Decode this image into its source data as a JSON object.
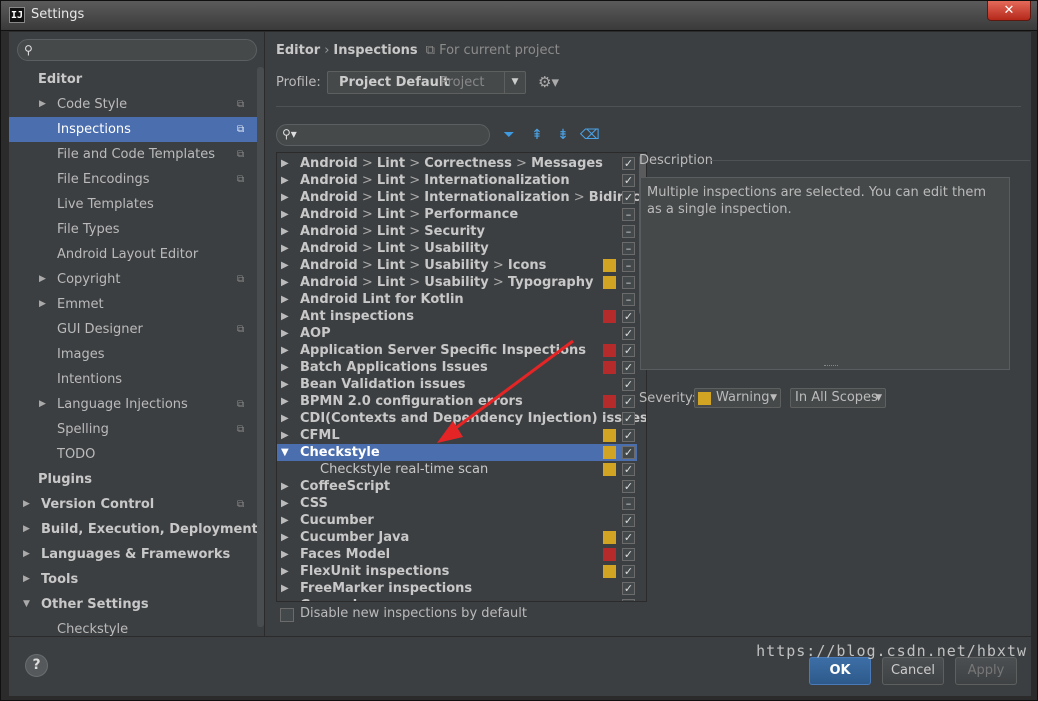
{
  "window": {
    "title": "Settings",
    "logo": "IJ",
    "close_glyph": "✕"
  },
  "sidebar": {
    "search_placeholder": "",
    "items": [
      {
        "label": "Editor",
        "level": 0,
        "arrow": "",
        "bold": true,
        "proj": false
      },
      {
        "label": "Code Style",
        "level": 1,
        "arrow": "▶",
        "bold": false,
        "proj": true
      },
      {
        "label": "Inspections",
        "level": 1,
        "arrow": "",
        "bold": false,
        "proj": true,
        "selected": true
      },
      {
        "label": "File and Code Templates",
        "level": 1,
        "arrow": "",
        "bold": false,
        "proj": true
      },
      {
        "label": "File Encodings",
        "level": 1,
        "arrow": "",
        "bold": false,
        "proj": true
      },
      {
        "label": "Live Templates",
        "level": 1,
        "arrow": "",
        "bold": false,
        "proj": false
      },
      {
        "label": "File Types",
        "level": 1,
        "arrow": "",
        "bold": false,
        "proj": false
      },
      {
        "label": "Android Layout Editor",
        "level": 1,
        "arrow": "",
        "bold": false,
        "proj": false
      },
      {
        "label": "Copyright",
        "level": 1,
        "arrow": "▶",
        "bold": false,
        "proj": true
      },
      {
        "label": "Emmet",
        "level": 1,
        "arrow": "▶",
        "bold": false,
        "proj": false
      },
      {
        "label": "GUI Designer",
        "level": 1,
        "arrow": "",
        "bold": false,
        "proj": true
      },
      {
        "label": "Images",
        "level": 1,
        "arrow": "",
        "bold": false,
        "proj": false
      },
      {
        "label": "Intentions",
        "level": 1,
        "arrow": "",
        "bold": false,
        "proj": false
      },
      {
        "label": "Language Injections",
        "level": 1,
        "arrow": "▶",
        "bold": false,
        "proj": true
      },
      {
        "label": "Spelling",
        "level": 1,
        "arrow": "",
        "bold": false,
        "proj": true
      },
      {
        "label": "TODO",
        "level": 1,
        "arrow": "",
        "bold": false,
        "proj": false
      },
      {
        "label": "Plugins",
        "level": 0,
        "arrow": "",
        "bold": true,
        "proj": false
      },
      {
        "label": "Version Control",
        "level": 0,
        "arrow": "▶",
        "bold": true,
        "proj": true
      },
      {
        "label": "Build, Execution, Deployment",
        "level": 0,
        "arrow": "▶",
        "bold": true,
        "proj": false
      },
      {
        "label": "Languages & Frameworks",
        "level": 0,
        "arrow": "▶",
        "bold": true,
        "proj": false
      },
      {
        "label": "Tools",
        "level": 0,
        "arrow": "▶",
        "bold": true,
        "proj": false
      },
      {
        "label": "Other Settings",
        "level": 0,
        "arrow": "▼",
        "bold": true,
        "proj": false
      },
      {
        "label": "Checkstyle",
        "level": 1,
        "arrow": "",
        "bold": false,
        "proj": false
      }
    ]
  },
  "header": {
    "crumb1": "Editor",
    "sep": "›",
    "crumb2": "Inspections",
    "project_note": "For current project",
    "profile_label": "Profile:",
    "profile_value": "Project Default",
    "profile_scope": "Project"
  },
  "inspections": [
    {
      "parts": [
        "Android",
        "Lint",
        "Correctness",
        "Messages"
      ],
      "sev": "",
      "check": "✓"
    },
    {
      "parts": [
        "Android",
        "Lint",
        "Internationalization"
      ],
      "sev": "",
      "check": "✓"
    },
    {
      "parts": [
        "Android",
        "Lint",
        "Internationalization",
        "Bidirecti"
      ],
      "sev": "",
      "check": "✓"
    },
    {
      "parts": [
        "Android",
        "Lint",
        "Performance"
      ],
      "sev": "",
      "check": "–"
    },
    {
      "parts": [
        "Android",
        "Lint",
        "Security"
      ],
      "sev": "",
      "check": "–"
    },
    {
      "parts": [
        "Android",
        "Lint",
        "Usability"
      ],
      "sev": "",
      "check": "–"
    },
    {
      "parts": [
        "Android",
        "Lint",
        "Usability",
        "Icons"
      ],
      "sev": "#d1a423",
      "check": "–"
    },
    {
      "parts": [
        "Android",
        "Lint",
        "Usability",
        "Typography"
      ],
      "sev": "#d1a423",
      "check": "–"
    },
    {
      "parts": [
        "Android Lint for Kotlin"
      ],
      "sev": "",
      "check": "–"
    },
    {
      "parts": [
        "Ant inspections"
      ],
      "sev": "#b52a2a",
      "check": "✓"
    },
    {
      "parts": [
        "AOP"
      ],
      "sev": "",
      "check": "✓"
    },
    {
      "parts": [
        "Application Server Specific Inspections"
      ],
      "sev": "#b52a2a",
      "check": "✓"
    },
    {
      "parts": [
        "Batch Applications Issues"
      ],
      "sev": "#b52a2a",
      "check": "✓"
    },
    {
      "parts": [
        "Bean Validation issues"
      ],
      "sev": "",
      "check": "✓"
    },
    {
      "parts": [
        "BPMN 2.0 configuration errors"
      ],
      "sev": "#b52a2a",
      "check": "✓"
    },
    {
      "parts": [
        "CDI(Contexts and Dependency Injection) issues"
      ],
      "sev": "",
      "check": "✓"
    },
    {
      "parts": [
        "CFML"
      ],
      "sev": "#d1a423",
      "check": "✓"
    },
    {
      "parts": [
        "Checkstyle"
      ],
      "sev": "#d1a423",
      "check": "✓",
      "selected": true,
      "expanded": true
    },
    {
      "parts": [
        "Checkstyle real-time scan"
      ],
      "sev": "#d1a423",
      "check": "✓",
      "child": true
    },
    {
      "parts": [
        "CoffeeScript"
      ],
      "sev": "",
      "check": "✓"
    },
    {
      "parts": [
        "CSS"
      ],
      "sev": "",
      "check": "–"
    },
    {
      "parts": [
        "Cucumber"
      ],
      "sev": "",
      "check": "✓"
    },
    {
      "parts": [
        "Cucumber Java"
      ],
      "sev": "#d1a423",
      "check": "✓"
    },
    {
      "parts": [
        "Faces Model"
      ],
      "sev": "#b52a2a",
      "check": "✓"
    },
    {
      "parts": [
        "FlexUnit inspections"
      ],
      "sev": "#d1a423",
      "check": "✓"
    },
    {
      "parts": [
        "FreeMarker inspections"
      ],
      "sev": "",
      "check": "✓"
    },
    {
      "parts": [
        "General"
      ],
      "sev": "",
      "check": "✓"
    }
  ],
  "description": {
    "label": "Description",
    "text": "Multiple inspections are selected. You can edit them as a single inspection."
  },
  "severity": {
    "label": "Severity:",
    "value": "Warning",
    "color": "#d1a423",
    "scope": "In All Scopes"
  },
  "disable_new": "Disable new inspections by default",
  "footer": {
    "help": "?",
    "ok": "OK",
    "cancel": "Cancel",
    "apply": "Apply"
  },
  "watermark": "https://blog.csdn.net/hbxtw",
  "colors": {
    "accent": "#4b6eaf",
    "warning": "#d1a423",
    "error": "#b52a2a"
  }
}
